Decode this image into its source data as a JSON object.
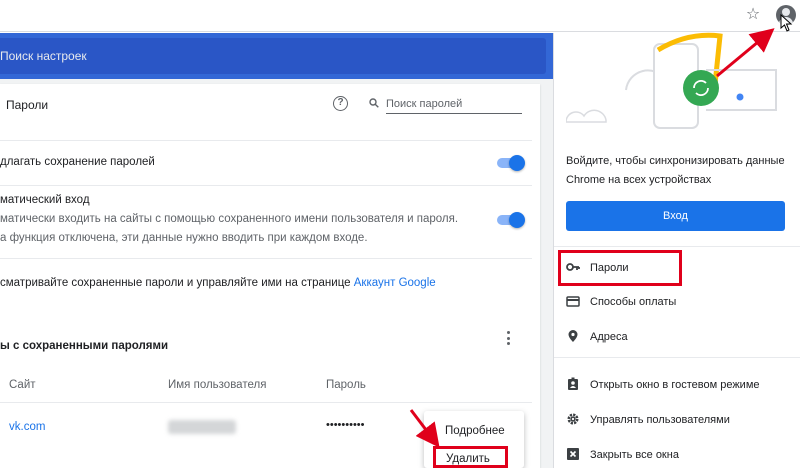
{
  "browser": {
    "star_icon": "star-icon",
    "avatar_icon": "profile-avatar-icon"
  },
  "settings": {
    "search_placeholder": "Поиск настроек",
    "section_title": "Пароли",
    "password_search_placeholder": "Поиск паролей",
    "offer_save": "длагать сохранение паролей",
    "autologin_title": "матический вход",
    "autologin_desc_1": "матически входить на сайты с помощью сохраненного имени пользователя и пароля.",
    "autologin_desc_2": "а функция отключена, эти данные нужно вводить при каждом входе.",
    "manage_prefix": "сматривайте сохраненные пароли и управляйте ими на странице ",
    "manage_link": "Аккаунт Google",
    "saved_title": "ы с сохраненными паролями",
    "columns": {
      "site": "Сайт",
      "username": "Имя пользователя",
      "password": "Пароль"
    },
    "rows": [
      {
        "site": "vk.com",
        "password": "••••••••••"
      }
    ],
    "offer_save_enabled": true,
    "autologin_enabled": true,
    "context_menu": {
      "details": "Подробнее",
      "delete": "Удалить"
    }
  },
  "popup": {
    "sync_text_1": "Войдите, чтобы синхронизировать данные",
    "sync_text_2": "Chrome на всех устройствах",
    "signin_label": "Вход",
    "items": [
      {
        "label": "Пароли",
        "icon": "key-icon"
      },
      {
        "label": "Способы оплаты",
        "icon": "credit-card-icon"
      },
      {
        "label": "Адреса",
        "icon": "location-pin-icon"
      },
      {
        "label": "Открыть окно в гостевом режиме",
        "icon": "guest-badge-icon"
      },
      {
        "label": "Управлять пользователями",
        "icon": "gear-icon"
      },
      {
        "label": "Закрыть все окна",
        "icon": "close-box-icon"
      }
    ]
  },
  "colors": {
    "accent": "#1a73e8",
    "header_blue": "#3367d6",
    "highlight_red": "#e0001b",
    "sync_green": "#34a853",
    "illustration_yellow": "#fbbc04"
  }
}
